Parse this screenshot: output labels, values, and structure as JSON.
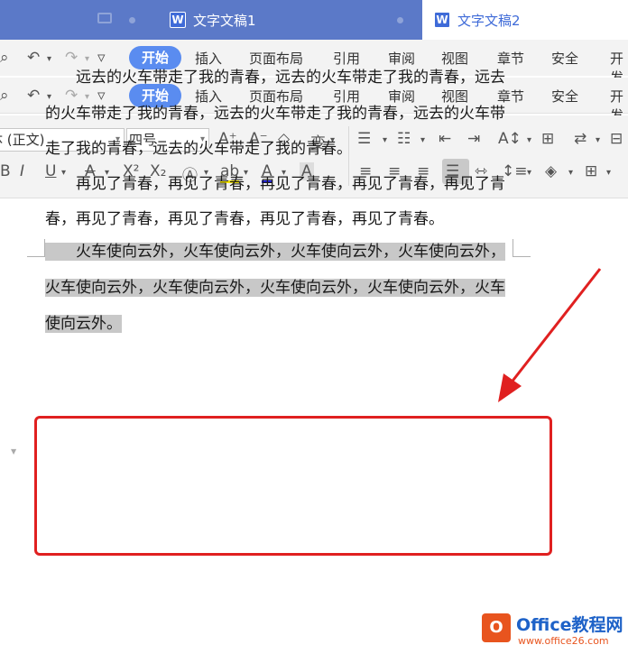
{
  "tabs": [
    {
      "title": ""
    },
    {
      "title": "文字文稿1"
    },
    {
      "title": "文字文稿2"
    }
  ],
  "menu": {
    "start": "开始",
    "items": [
      "插入",
      "页面布局",
      "引用",
      "审阅",
      "视图",
      "章节",
      "安全",
      "开发"
    ]
  },
  "toolbar": {
    "font_name": "宋体 (正文)",
    "font_size": "四号"
  },
  "document": {
    "paragraphs": [
      {
        "lines": [
          "　　远去的火车带走了我的青春，远去的火车带走了我的青春，远去",
          "的火车带走了我的青春，远去的火车带走了我的青春，远去的火车带",
          "走了我的青春，远去的火车带走了我的青春。"
        ]
      },
      {
        "lines": [
          "　　再见了青春，再见了青春，再见了青春，再见了青春，再见了青",
          "春，再见了青春，再见了青春，再见了青春，再见了青春。"
        ]
      },
      {
        "lines": [
          "　　火车使向云外，火车使向云外，火车使向云外，火车使向云外，",
          "火车使向云外，火车使向云外，火车使向云外，火车使向云外，火车",
          "使向云外。"
        ]
      }
    ]
  },
  "watermark": {
    "logo_text": "O",
    "brand": "Office教程网",
    "url": "www.office26.com"
  },
  "colors": {
    "tab_bar": "#5b79c8",
    "accent": "#5a8cf0",
    "highlight_box": "#e02020",
    "selection": "#c8c8c8"
  }
}
